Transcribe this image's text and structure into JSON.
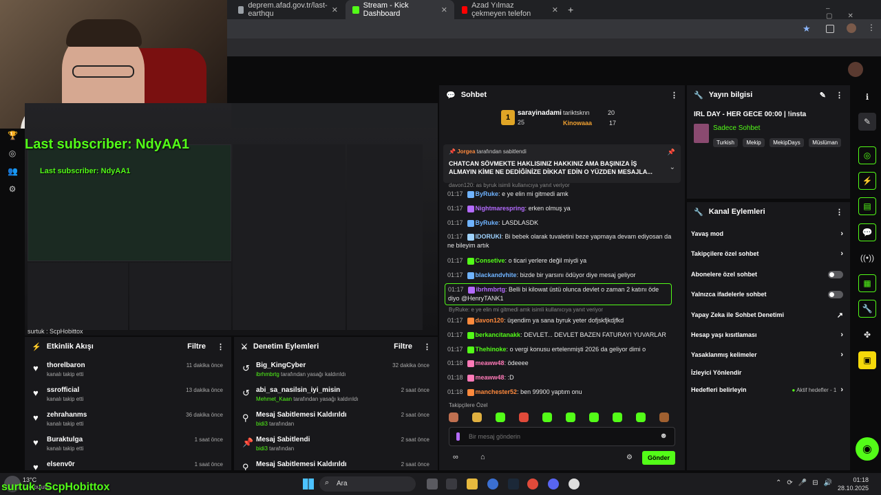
{
  "browser": {
    "tabs": [
      {
        "label": "deprem.afad.gov.tr/last-earthqu",
        "color": "#9aa0a6"
      },
      {
        "label": "Stream - Kick Dashboard",
        "color": "#53fc18"
      },
      {
        "label": "Azad Yılmaz çekmeyen telefon",
        "color": "#ff0000"
      }
    ]
  },
  "overlay": {
    "last_sub": "Last subscriber: NdyAA1",
    "last_sub_small": "Last subscriber: NdyAA1",
    "footer_name": "surtuk : ScpHobittox",
    "bottom_name": "surtuk : ScpHobittox"
  },
  "activity": {
    "title": "Etkinlik Akışı",
    "filter": "Filtre",
    "items": [
      {
        "name": "thorelbaron",
        "sub": "kanalı takip etti",
        "time": "11 dakika önce"
      },
      {
        "name": "ssrofficial",
        "sub": "kanalı takip etti",
        "time": "13 dakika önce"
      },
      {
        "name": "zehrahanms",
        "sub": "kanalı takip etti",
        "time": "36 dakika önce"
      },
      {
        "name": "Buraktulga",
        "sub": "kanalı takip etti",
        "time": "1 saat önce"
      },
      {
        "name": "elsenv0r",
        "sub": "",
        "time": "1 saat önce"
      }
    ]
  },
  "moderation": {
    "title": "Denetim Eylemleri",
    "filter": "Filtre",
    "items": [
      {
        "name": "Big_KingCyber",
        "user": "ibrhmbrtg",
        "sub": "tarafından yasağı kaldırıldı",
        "time": "32 dakika önce"
      },
      {
        "name": "abi_sa_nasilsin_iyi_misin",
        "user": "Mehmet_Kaan",
        "sub": "tarafından yasağı kaldırıldı",
        "time": "2 saat önce"
      },
      {
        "name": "Mesaj Sabitlemesi Kaldırıldı",
        "user": "bidi3",
        "sub": "tarafından",
        "time": "2 saat önce"
      },
      {
        "name": "Mesaj Sabitlendi",
        "user": "bidi3",
        "sub": "tarafından",
        "time": "2 saat önce"
      },
      {
        "name": "Mesaj Sabitlemesi Kaldırıldı",
        "user": "",
        "sub": "",
        "time": "2 saat önce"
      }
    ]
  },
  "chat": {
    "title": "Sohbet",
    "leaders": {
      "first": "sarayinadami",
      "first_count": "25",
      "second": "tariktsknn",
      "second_count": "20",
      "third": "Kinowaaa",
      "third_count": "17"
    },
    "pinned_by": "Jorgea",
    "pinned_suffix": "tarafından sabitlendi",
    "pinned_text": "CHATCAN SÖVMEKTE HAKLISINIZ HAKKINIZ AMA BAŞINIZA İŞ ALMAYIN KİME NE DEDİĞİNİZE DİKKAT EDİN O YÜZDEN MESAJLA...",
    "messages": [
      {
        "reply": "davon120: as byruk isimli kullanıcıya yanıt veriyor"
      },
      {
        "time": "01:17",
        "user": "ByRuke",
        "color": "#6fb3ff",
        "text": "e ye elin mi gitmedi amk"
      },
      {
        "time": "01:17",
        "user": "Nightmarespring",
        "color": "#b46bff",
        "text": "erken olmuş ya"
      },
      {
        "time": "01:17",
        "user": "ByRuke",
        "color": "#6fb3ff",
        "text": "LASDLASDK"
      },
      {
        "time": "01:17",
        "user": "IDORUKI",
        "color": "#9fd3ff",
        "text": "Bi bebek olarak tuvaletini beze yapmaya devam ediyosan da ne bileyim artık"
      },
      {
        "time": "01:17",
        "user": "Consetive",
        "color": "#53fc18",
        "text": "o ticari yerlere değil miydi ya"
      },
      {
        "time": "01:17",
        "user": "blackandvhite",
        "color": "#6fb3ff",
        "text": "bizde bir yarsını ödüyor diye mesaj geliyor"
      },
      {
        "time": "01:17",
        "user": "ibrhmbrtg",
        "color": "#b46bff",
        "text": "Belli bi kilowat üstü olunca devlet o zaman 2 katını öde diyo @HenryTANK1"
      },
      {
        "reply": "ByRuke: e ye elin mi gitmedi amk isimli kullanıcıya yanıt veriyor"
      },
      {
        "time": "01:17",
        "user": "davon120",
        "color": "#ff8a3d",
        "text": "üşendim ya sana byruk yeter dofjskfjkdjfkd"
      },
      {
        "time": "01:17",
        "user": "berkancitanakk",
        "color": "#53fc18",
        "text": "DEVLET... DEVLET BAZEN FATURAYI YUVARLAR"
      },
      {
        "time": "01:17",
        "user": "Thehinoke",
        "color": "#53fc18",
        "text": "o vergi konusu ertelenmişti 2026 da geliyor dimi o"
      },
      {
        "time": "01:18",
        "user": "meaww48",
        "color": "#ff7ab8",
        "text": "ödeeee"
      },
      {
        "time": "01:18",
        "user": "meaww48",
        "color": "#ff7ab8",
        "text": ":D"
      },
      {
        "time": "01:18",
        "user": "manchester52",
        "color": "#ff8a3d",
        "text": "ben 99900 yaptım onu"
      }
    ],
    "emote_label": "Takipçilere Özel",
    "input_placeholder": "Bir mesaj gönderin",
    "send": "Gönder"
  },
  "stream_info": {
    "title": "Yayın bilgisi",
    "stream_title": "IRL DAY - HER GECE 00:00 | !insta",
    "mode": "Sadece Sohbet",
    "tags": [
      "Turkish",
      "Mekip",
      "MekipDays",
      "Müslüman"
    ]
  },
  "channel_actions": {
    "title": "Kanal Eylemleri",
    "items": [
      {
        "label": "Yavaş mod",
        "control": "chevron"
      },
      {
        "label": "Takipçilere özel sohbet",
        "control": "chevron"
      },
      {
        "label": "Abonelere özel sohbet",
        "control": "toggle"
      },
      {
        "label": "Yalnızca ifadelerle sohbet",
        "control": "toggle"
      },
      {
        "label": "Yapay Zeka ile Sohbet Denetimi",
        "control": "external"
      },
      {
        "label": "Hesap yaşı kısıtlaması",
        "control": "chevron"
      },
      {
        "label": "Yasaklanmış kelimeler",
        "control": "chevron"
      },
      {
        "label": "İzleyici Yönlendir",
        "control": "none"
      },
      {
        "label": "Hedefleri belirleyin",
        "control": "chevron",
        "extra": "Aktif hedefler - 1"
      }
    ]
  },
  "taskbar": {
    "search": "Ara",
    "weather": "13°C",
    "weather_sub": "Çok bulutlu",
    "time": "01:18",
    "date": "28.10.2025"
  }
}
